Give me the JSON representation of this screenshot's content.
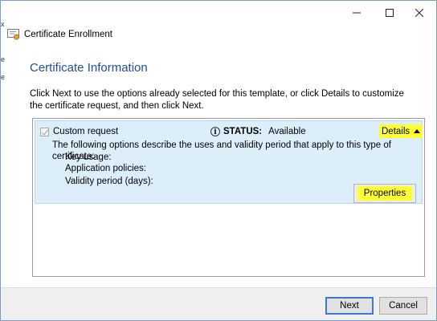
{
  "window": {
    "title": "Certificate Enrollment",
    "controls": [
      "minimize",
      "maximize",
      "close"
    ]
  },
  "page": {
    "heading": "Certificate Information",
    "intro": "Click Next to use the options already selected for this template, or click Details to customize the certificate request, and then click Next."
  },
  "certificate": {
    "name": "Custom request",
    "checked": true,
    "status_label": "STATUS:",
    "status_value": "Available",
    "details_label": "Details",
    "description": "The following options describe the uses and validity period that apply to this type of certificate:",
    "fields": [
      "Key usage:",
      "Application policies:",
      "Validity period (days):"
    ],
    "properties_label": "Properties"
  },
  "footer": {
    "next_label": "Next",
    "cancel_label": "Cancel"
  },
  "colors": {
    "heading": "#1e4e9c",
    "highlight": "#ffff33",
    "item_background": "#dceefa",
    "primary_border": "#3b79d7"
  }
}
